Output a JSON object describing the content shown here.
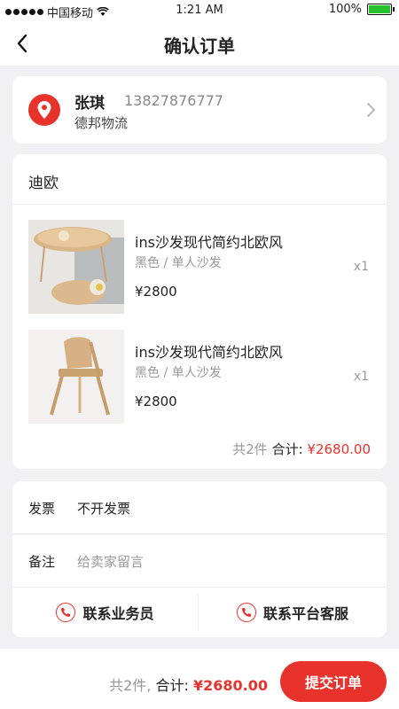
{
  "status_bar": {
    "carrier": "中国移动",
    "time": "1:21 AM",
    "battery_text": "100%",
    "battery_level": 1.0
  },
  "nav": {
    "title": "确认订单",
    "back_icon": "chevron-left-icon"
  },
  "address": {
    "name": "张琪",
    "phone": "13827876777",
    "company": "德邦物流",
    "icon": "location-pin-icon"
  },
  "shop": {
    "name": "迪欧",
    "items": [
      {
        "title": "ins沙发现代简约北欧风",
        "spec": "黑色 / 单人沙发",
        "price": "¥2800",
        "qty": "x1"
      },
      {
        "title": "ins沙发现代简约北欧风",
        "spec": "黑色 / 单人沙发",
        "price": "¥2800",
        "qty": "x1"
      }
    ],
    "count_text": "共2件",
    "total_label": "合计:",
    "total_amount": "¥2680.00"
  },
  "invoice": {
    "label": "发票",
    "value": "不开发票"
  },
  "remark": {
    "label": "备注",
    "placeholder": "给卖家留言"
  },
  "contacts": {
    "salesperson_label": "联系业务员",
    "platform_label": "联系平台客服",
    "icon": "phone-icon"
  },
  "footer": {
    "count_text": "共2件,",
    "total_label": "合计:",
    "total_amount": "¥2680.00",
    "submit_label": "提交订单"
  },
  "colors": {
    "accent": "#e8332d",
    "background": "#f1f1f4",
    "muted": "#999999"
  }
}
